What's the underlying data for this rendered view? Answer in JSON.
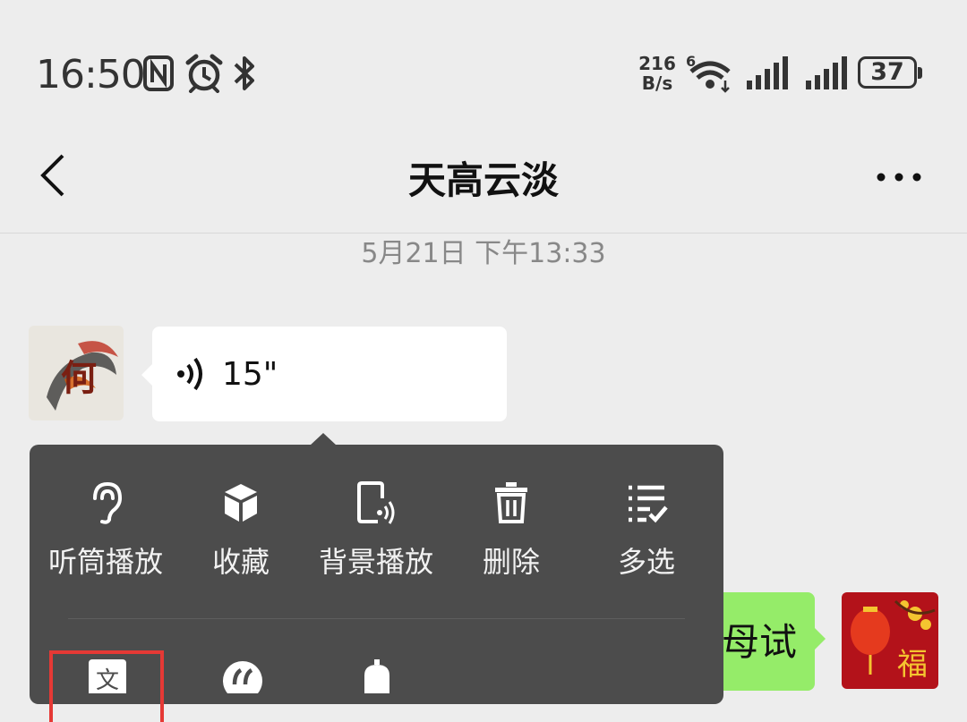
{
  "status_bar": {
    "time": "16:50",
    "net_speed_value": "216",
    "net_speed_unit": "B/s",
    "wifi_badge": "6",
    "battery": "37",
    "icons": [
      "nfc-icon",
      "alarm-icon",
      "bluetooth-icon",
      "wifi-icon",
      "signal-icon",
      "signal-icon",
      "battery-icon"
    ]
  },
  "header": {
    "title": "天高云淡",
    "back_icon": "chevron-left-icon",
    "more_icon": "more-dots-icon"
  },
  "chat": {
    "timestamp": "5月21日 下午13:33",
    "voice_message": {
      "duration": "15\"",
      "icon": "voice-waves-icon"
    },
    "right_message_partial_text": "母试"
  },
  "context_menu": {
    "row1": [
      {
        "label": "听筒播放",
        "icon": "ear-icon"
      },
      {
        "label": "收藏",
        "icon": "cube-icon"
      },
      {
        "label": "背景播放",
        "icon": "phone-sound-icon"
      },
      {
        "label": "删除",
        "icon": "trash-icon"
      },
      {
        "label": "多选",
        "icon": "multi-select-icon"
      }
    ],
    "row2_icons": [
      "translate-icon",
      "quote-icon",
      "remind-icon"
    ],
    "row2_first_glyph": "文",
    "highlight_color": "#e53935"
  },
  "colors": {
    "background": "#ededed",
    "menu_background": "#4c4c4c",
    "bubble_green": "#95ec69",
    "bubble_white": "#ffffff"
  }
}
